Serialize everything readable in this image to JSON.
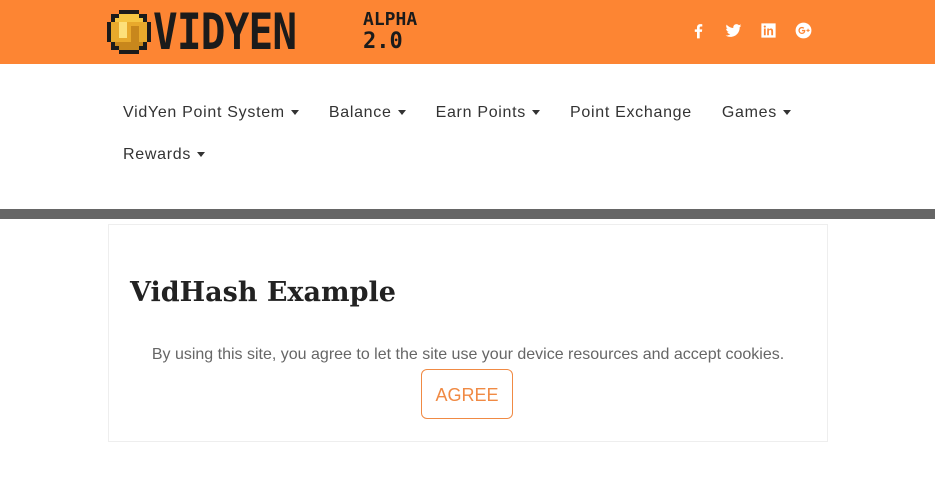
{
  "header": {
    "logo": {
      "wordmark": "VIDYEN",
      "tag": "ALPHA",
      "version": "2.0"
    },
    "social": [
      {
        "name": "facebook",
        "icon": "facebook-icon"
      },
      {
        "name": "twitter",
        "icon": "twitter-icon"
      },
      {
        "name": "linkedin",
        "icon": "linkedin-icon"
      },
      {
        "name": "google-plus",
        "icon": "google-plus-icon"
      }
    ],
    "bar_color": "#fd8533"
  },
  "nav": {
    "items": [
      {
        "label": "VidYen Point System",
        "dropdown": true
      },
      {
        "label": "Balance",
        "dropdown": true
      },
      {
        "label": "Earn Points",
        "dropdown": true
      },
      {
        "label": "Point Exchange",
        "dropdown": false
      },
      {
        "label": "Games",
        "dropdown": true
      },
      {
        "label": "Rewards",
        "dropdown": true
      }
    ]
  },
  "main": {
    "title": "VidHash Example",
    "notice": "By using this site, you agree to let the site use your device resources and accept cookies.",
    "agree_label": "AGREE",
    "accent": "#f08a44"
  }
}
